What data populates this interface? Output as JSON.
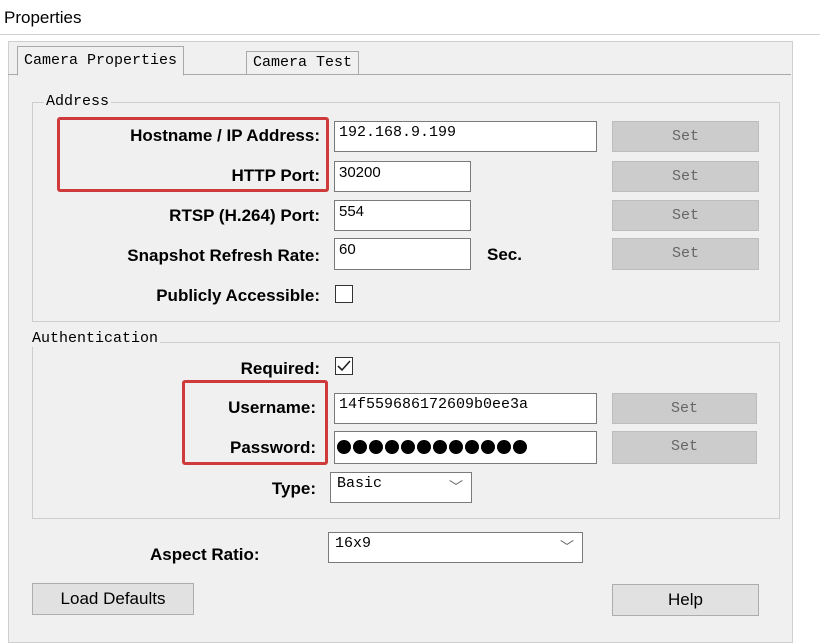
{
  "window": {
    "title": "Properties"
  },
  "tabs": [
    {
      "label": "Camera Properties",
      "active": true
    },
    {
      "label": "Camera Test",
      "active": false
    }
  ],
  "address": {
    "legend": "Address",
    "hostname": {
      "label": "Hostname / IP Address:",
      "value": "192.168.9.199",
      "button": "Set"
    },
    "http_port": {
      "label": "HTTP Port:",
      "value": "30200",
      "button": "Set"
    },
    "rtsp_port": {
      "label": "RTSP (H.264) Port:",
      "value": "554",
      "button": "Set"
    },
    "snapshot": {
      "label": "Snapshot Refresh Rate:",
      "value": "60",
      "unit": "Sec.",
      "button": "Set"
    },
    "public": {
      "label": "Publicly Accessible:",
      "checked": false
    }
  },
  "auth": {
    "legend": "Authentication",
    "required": {
      "label": "Required:",
      "checked": true
    },
    "username": {
      "label": "Username:",
      "value": "14f559686172609b0ee3a",
      "button": "Set"
    },
    "password": {
      "label": "Password:",
      "masked_count": 12,
      "button": "Set"
    },
    "type": {
      "label": "Type:",
      "value": "Basic"
    }
  },
  "aspect": {
    "label": "Aspect Ratio:",
    "value": "16x9"
  },
  "footer": {
    "load_defaults": "Load Defaults",
    "help": "Help"
  },
  "highlight_color": "#cf3a3a",
  "icons": {
    "checkbox_check": "check-icon",
    "dropdown_arrow": "chevron-down-icon"
  }
}
